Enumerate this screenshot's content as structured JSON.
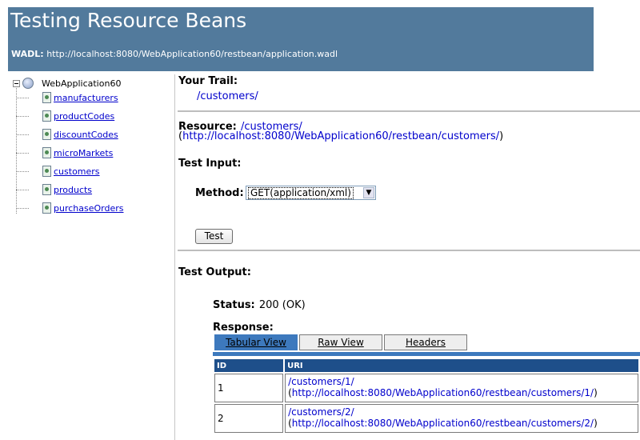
{
  "header": {
    "title": "Testing Resource Beans",
    "wadl_label": "WADL:",
    "wadl_url": "http://localhost:8080/WebApplication60/restbean/application.wadl"
  },
  "tree": {
    "root": "WebApplication60",
    "items": [
      {
        "label": "manufacturers"
      },
      {
        "label": "productCodes"
      },
      {
        "label": "discountCodes"
      },
      {
        "label": "microMarkets"
      },
      {
        "label": "customers"
      },
      {
        "label": "products"
      },
      {
        "label": "purchaseOrders"
      }
    ]
  },
  "main": {
    "trail_label": "Your Trail:",
    "trail_link": "/customers/",
    "resource_label": "Resource:",
    "resource_link": "/customers/",
    "resource_open": "(",
    "resource_url": "http://localhost:8080/WebApplication60/restbean/customers/",
    "resource_close": ")",
    "test_input_label": "Test Input:",
    "method_label": "Method:",
    "method_value": "GET(application/xml)",
    "test_button": "Test",
    "test_output_label": "Test Output:",
    "status_label": "Status:",
    "status_value": "200 (OK)",
    "response_label": "Response:",
    "tabs": [
      {
        "label": "Tabular View",
        "active": true
      },
      {
        "label": "Raw View",
        "active": false
      },
      {
        "label": "Headers",
        "active": false
      }
    ],
    "table": {
      "columns": [
        "ID",
        "URI"
      ],
      "rows": [
        {
          "id": "1",
          "uri": "/customers/1/",
          "open": "(",
          "full": "http://localhost:8080/WebApplication60/restbean/customers/1/",
          "close": ")"
        },
        {
          "id": "2",
          "uri": "/customers/2/",
          "open": "(",
          "full": "http://localhost:8080/WebApplication60/restbean/customers/2/",
          "close": ")"
        }
      ]
    }
  },
  "colors": {
    "header_bg": "#527a9c",
    "tab_active": "#3d79bd",
    "table_header": "#1e4f8a",
    "link": "#0000cc"
  },
  "icons": [
    "minus-icon",
    "globe-icon",
    "document-icon",
    "dropdown-arrow-icon"
  ]
}
